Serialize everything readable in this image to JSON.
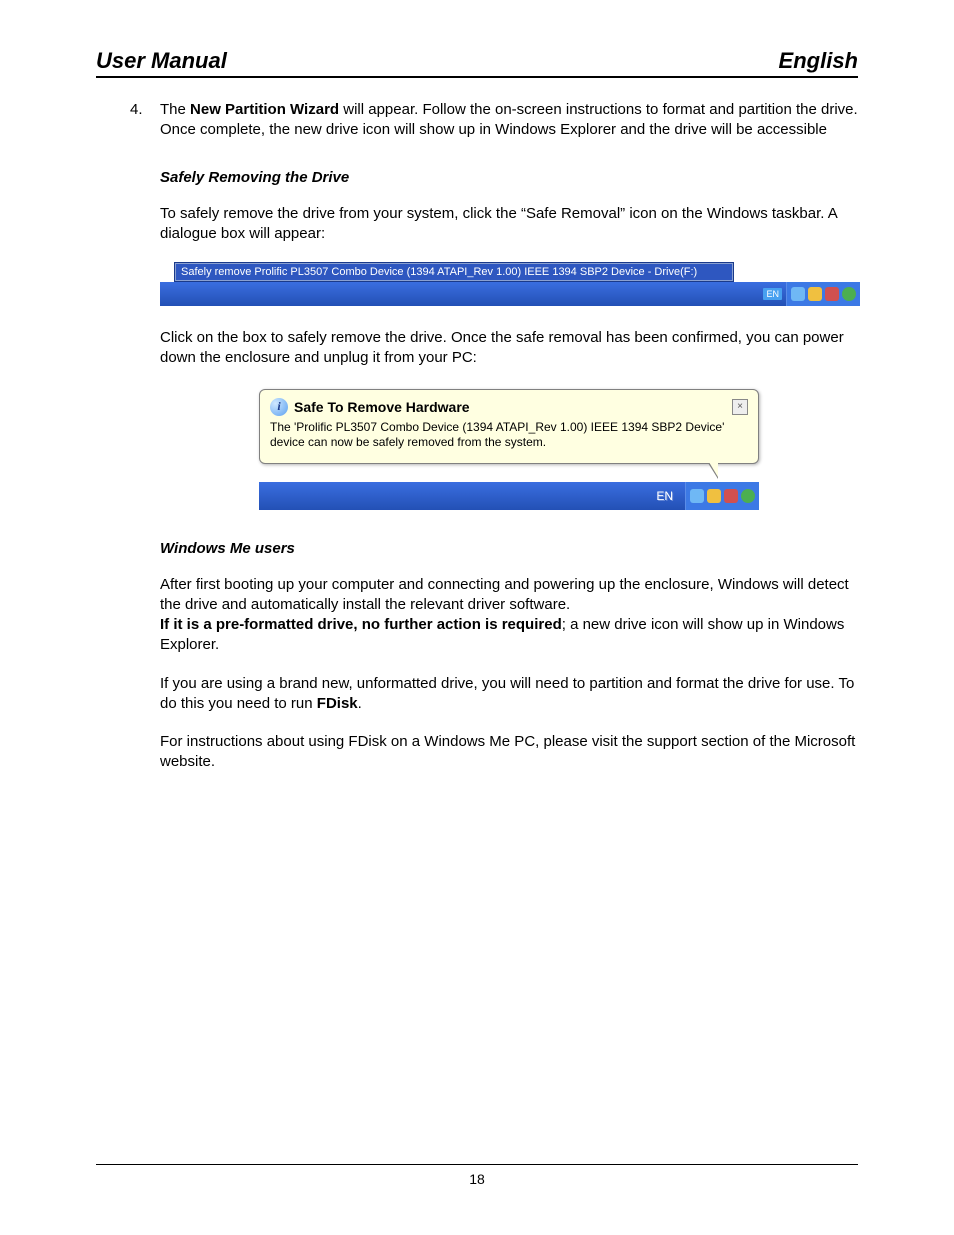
{
  "header": {
    "left": "User Manual",
    "right": "English"
  },
  "step4": {
    "num": "4.",
    "pre": "The ",
    "bold": "New Partition Wizard",
    "post": " will appear. Follow the on-screen instructions to format and partition the drive. Once complete, the new drive icon will show up in Windows Explorer and the drive will be accessible"
  },
  "sec1": {
    "title": "Safely Removing the Drive",
    "p1": "To safely remove the drive from your system, click the “Safe Removal” icon on the Windows taskbar. A dialogue box will appear:",
    "p2": "Click on the box to safely remove the drive. Once the safe removal has been confirmed, you can power down the enclosure and unplug it from your PC:"
  },
  "shot1": {
    "tooltip": "Safely remove Prolific PL3507 Combo Device (1394 ATAPI_Rev 1.00) IEEE 1394 SBP2 Device - Drive(F:)",
    "lang": "EN"
  },
  "shot2": {
    "title": "Safe To Remove Hardware",
    "body": "The 'Prolific PL3507 Combo Device (1394 ATAPI_Rev 1.00) IEEE 1394 SBP2 Device' device can now be safely removed from the system.",
    "close": "×",
    "lang": "EN"
  },
  "sec2": {
    "title": "Windows Me users",
    "p1": "After first booting up your computer and connecting and powering up the enclosure, Windows will detect the drive and automatically install the relevant driver software.",
    "p2a": "If it is a pre-formatted drive, no further action is required",
    "p2b": "; a new drive icon will show up in Windows Explorer.",
    "p3a": "If you are using a brand new, unformatted drive, you will need to partition and format the drive for use. To do this you need to run ",
    "p3b": "FDisk",
    "p3c": ".",
    "p4": "For instructions about using FDisk on a Windows Me PC, please visit the support section of the Microsoft website."
  },
  "footer": {
    "page": "18"
  }
}
